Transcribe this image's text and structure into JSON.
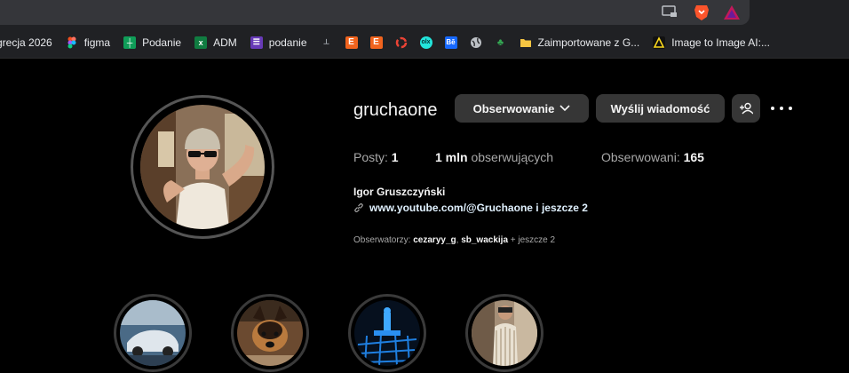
{
  "bookmarks": [
    {
      "label": "grecja 2026",
      "icon": "none",
      "color": ""
    },
    {
      "label": "figma",
      "icon": "figma-icon",
      "color": "#f24e1e"
    },
    {
      "label": "Podanie",
      "icon": "sheets-icon",
      "color": "#0f9d58"
    },
    {
      "label": "ADM",
      "icon": "excel-icon",
      "color": "#107c41"
    },
    {
      "label": "podanie",
      "icon": "forms-icon",
      "color": "#673ab7"
    },
    {
      "label": "",
      "icon": "tool-icon",
      "color": "#9aa0a6"
    },
    {
      "label": "",
      "icon": "etsy-icon",
      "color": "#f1641e"
    },
    {
      "label": "",
      "icon": "etsy-icon",
      "color": "#f1641e"
    },
    {
      "label": "",
      "icon": "ring-icon",
      "color": "#ea4335"
    },
    {
      "label": "",
      "icon": "olx-icon",
      "color": "#23e5db"
    },
    {
      "label": "",
      "icon": "behance-icon",
      "color": "#1769ff"
    },
    {
      "label": "",
      "icon": "globe-icon",
      "color": "#bdc1c6"
    },
    {
      "label": "",
      "icon": "leaf-icon",
      "color": "#34a853"
    },
    {
      "label": "Zaimportowane z G...",
      "icon": "folder-icon",
      "color": "#f5c542"
    },
    {
      "label": "Image to Image AI:...",
      "icon": "ai-icon",
      "color": "#f9d71c"
    }
  ],
  "profile": {
    "username": "gruchaone",
    "follow_button": "Obserwowanie",
    "message_button": "Wyślij wiadomość",
    "posts_label": "Posty:",
    "posts_value": "1",
    "followers_value": "1 mln",
    "followers_label": "obserwujących",
    "following_label": "Obserwowani:",
    "following_value": "165",
    "full_name": "Igor Gruszczyński",
    "link_text": "www.youtube.com/@Gruchaone i jeszcze 2",
    "mutuals_prefix": "Obserwatorzy:",
    "mutual_1": "cezaryy_g",
    "mutual_sep": ",",
    "mutual_2": "sb_wackija",
    "mutuals_suffix": "+ jeszcze 2"
  },
  "colors": {
    "background": "#000000",
    "button": "#363636",
    "muted_text": "#a8a8a8"
  }
}
